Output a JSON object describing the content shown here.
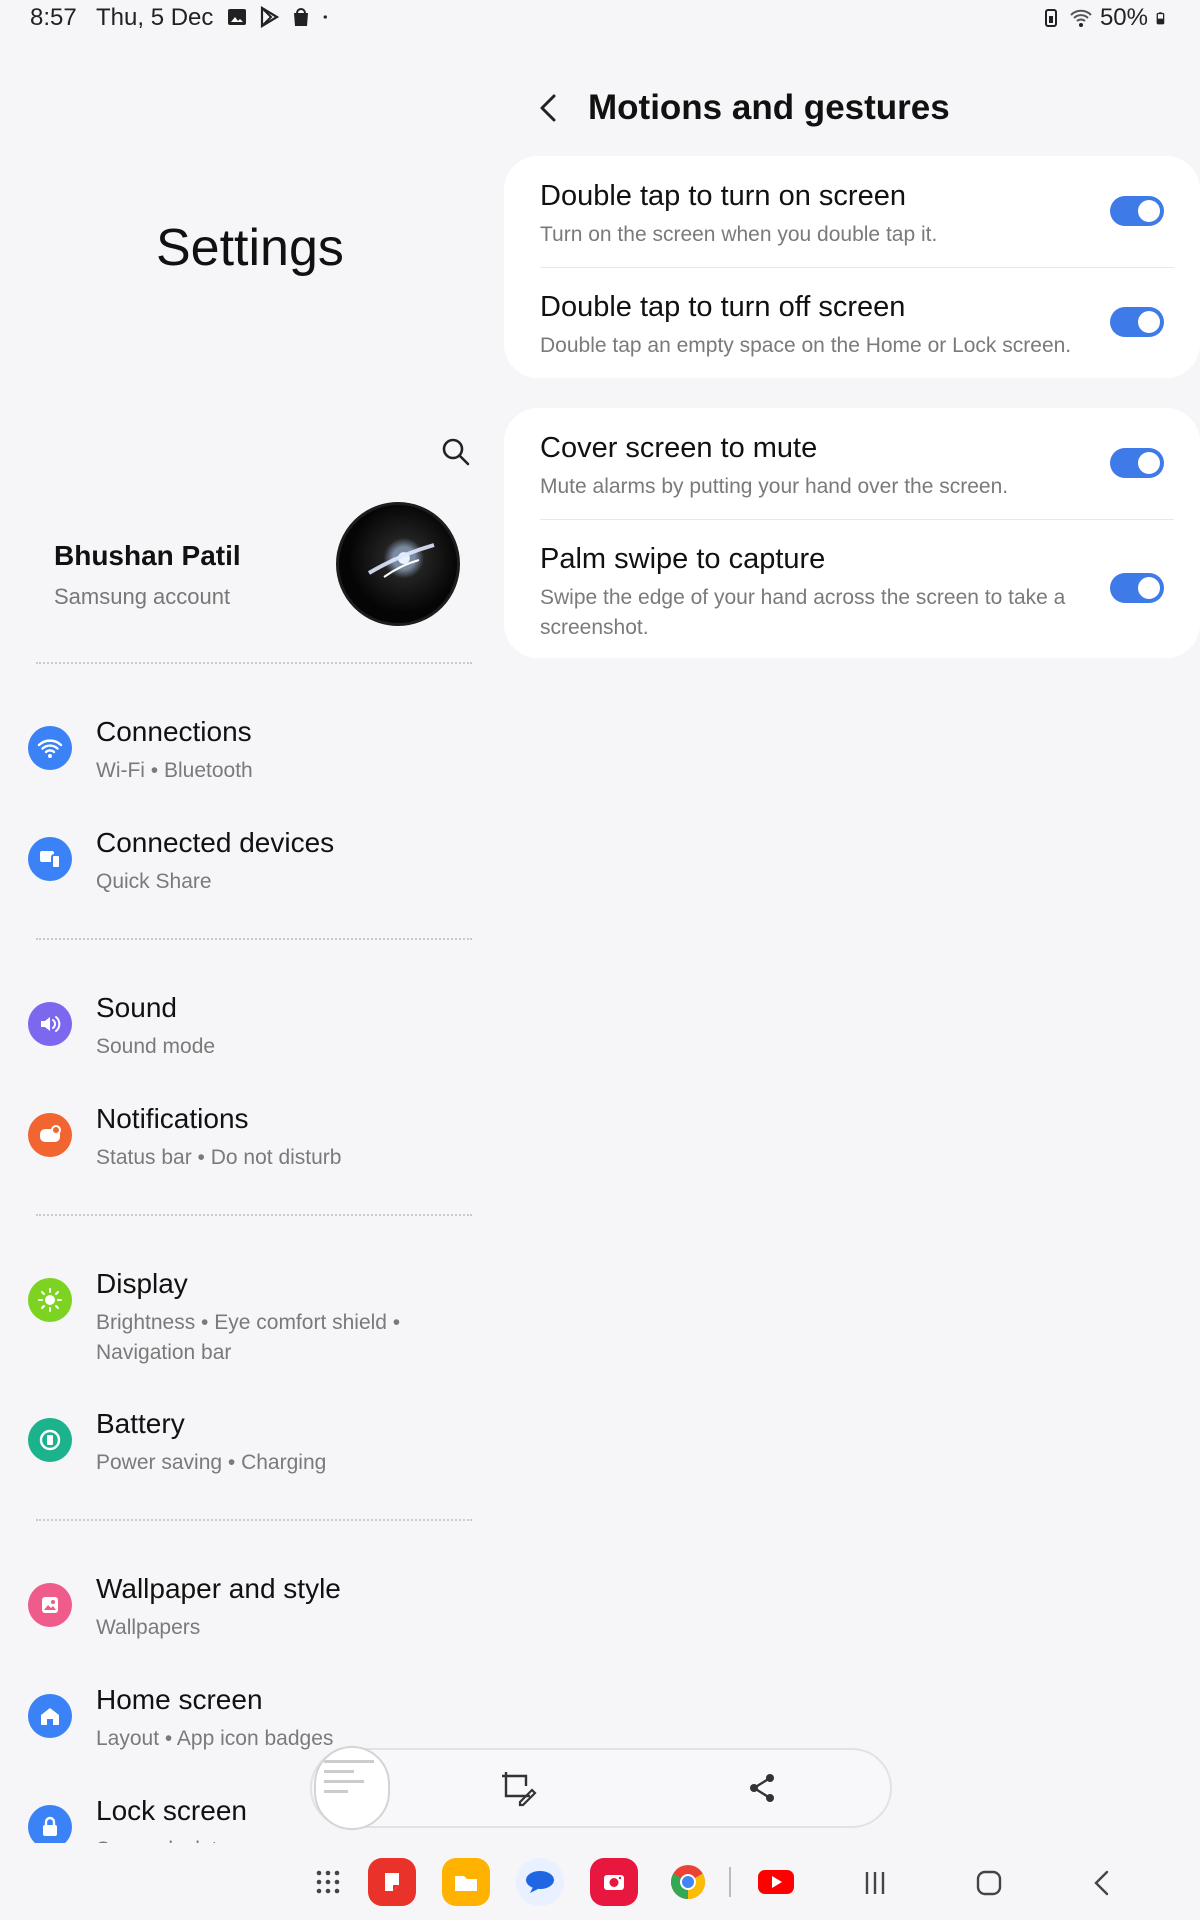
{
  "status_bar": {
    "time": "8:57",
    "date": "Thu, 5 Dec",
    "battery": "50%",
    "left_icons": [
      "gallery-icon",
      "play-store-icon",
      "shopping-bag-icon",
      "dot-icon"
    ],
    "right_icons": [
      "battery-saver-icon",
      "wifi-icon",
      "battery-icon"
    ]
  },
  "left_pane": {
    "title": "Settings",
    "search_icon": "search-icon",
    "profile": {
      "name": "Bhushan Patil",
      "subtitle": "Samsung account"
    },
    "items": [
      {
        "title": "Connections",
        "subtitle": "Wi-Fi  •  Bluetooth",
        "icon": "wifi-icon",
        "color": "#3b82f6"
      },
      {
        "title": "Connected devices",
        "subtitle": "Quick Share",
        "icon": "devices-icon",
        "color": "#3b82f6"
      },
      {
        "title": "Sound",
        "subtitle": "Sound mode",
        "icon": "speaker-icon",
        "color": "#7b68ee"
      },
      {
        "title": "Notifications",
        "subtitle": "Status bar  •  Do not disturb",
        "icon": "notification-icon",
        "color": "#f26430"
      },
      {
        "title": "Display",
        "subtitle": "Brightness  •  Eye comfort shield  •",
        "subtitle2": "Navigation bar",
        "icon": "sun-icon",
        "color": "#7dd321"
      },
      {
        "title": "Battery",
        "subtitle": "Power saving  •  Charging",
        "icon": "battery-icon",
        "color": "#1bb28c"
      },
      {
        "title": "Wallpaper and style",
        "subtitle": "Wallpapers",
        "icon": "wallpaper-icon",
        "color": "#ef5b8a"
      },
      {
        "title": "Home screen",
        "subtitle": "Layout  •  App icon badges",
        "icon": "home-icon",
        "color": "#3b82f6"
      },
      {
        "title": "Lock screen",
        "subtitle": "Screen lock type",
        "icon": "lock-icon",
        "color": "#3b82f6"
      }
    ]
  },
  "right_pane": {
    "title": "Motions and gestures",
    "cards": [
      [
        {
          "title": "Double tap to turn on screen",
          "subtitle": "Turn on the screen when you double tap it.",
          "on": true
        },
        {
          "title": "Double tap to turn off screen",
          "subtitle": "Double tap an empty space on the Home or Lock screen.",
          "on": true
        }
      ],
      [
        {
          "title": "Cover screen to mute",
          "subtitle": "Mute alarms by putting your hand over the screen.",
          "on": true
        },
        {
          "title": "Palm swipe to capture",
          "subtitle": "Swipe the edge of your hand across the screen to take a screenshot.",
          "on": true
        }
      ]
    ]
  },
  "screenshot_toolbar": {
    "icons": [
      "screenshot-thumbnail",
      "crop-edit-icon",
      "share-icon"
    ]
  },
  "taskbar": {
    "apps": [
      "apps-grid-icon",
      "notes-app-icon",
      "files-app-icon",
      "messages-app-icon",
      "camera-app-icon",
      "chrome-app-icon",
      "youtube-app-icon"
    ],
    "nav": [
      "recents-icon",
      "home-nav-icon",
      "back-nav-icon"
    ]
  },
  "colors": {
    "accent": "#3f7be8",
    "background": "#f6f6f8",
    "card": "#ffffff"
  }
}
